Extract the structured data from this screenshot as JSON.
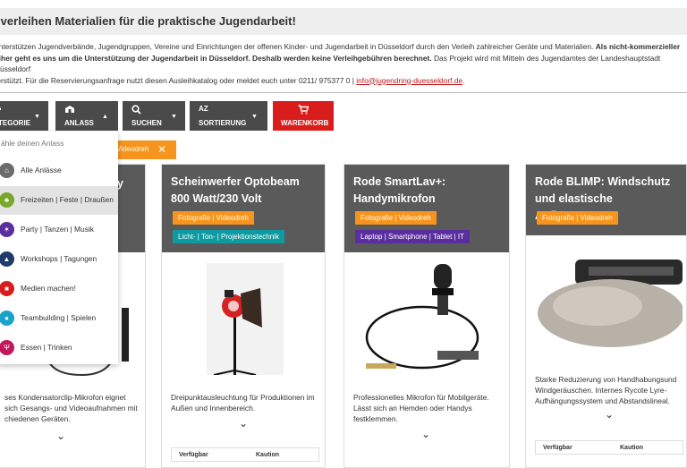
{
  "header": {
    "title": "r verleihen Materialien für die praktische Jugendarbeit!"
  },
  "intro": {
    "line1_normal": "unterstützen Jugendverbände, Jugendgruppen, Vereine und Einrichtungen der offenen Kinder- und Jugendarbeit in Düsseldorf durch den Verleih zahlreicher Geräte und Materialien. ",
    "line1_bold": "Als nicht-kommerzieller",
    "line2_bold": "eiher geht es uns um die Unterstützung der Jugendarbeit in Düsseldorf. Deshalb werden keine Verleihgebühren berechnet.",
    "line2_normal": " Das Projekt wird mit Mitteln des Jugendamtes der Landeshauptstadt Düsseldorf",
    "line3": "terstützt.  Für die Reservierungsanfrage nutzt diesen Ausleihkatalog oder meldet euch unter 0211/ 975377 0 | ",
    "email": "info@jugendring-duesseldorf.de",
    "line3_end": "."
  },
  "filters": {
    "kategorie": "TEGORIE",
    "anlass": "ANLASS",
    "suchen": "SUCHEN",
    "sortierung": "SORTIERUNG",
    "warenkorb": "WARENKORB",
    "sort_icon": "AZ"
  },
  "active_chip": {
    "label": "Videodreh"
  },
  "dropdown": {
    "header": "ähle deinen Anlass",
    "items": [
      {
        "label": "Alle Anlässe",
        "icon": "home-icon",
        "color": "#6b6b6b"
      },
      {
        "label": "Freizeiten | Feste | Draußen",
        "icon": "tree-icon",
        "color": "#7aa62b"
      },
      {
        "label": "Party | Tanzen | Musik",
        "icon": "sparkle-icon",
        "color": "#5b2ea0"
      },
      {
        "label": "Workshops | Tagungen",
        "icon": "graduation-cap-icon",
        "color": "#1f3b6b"
      },
      {
        "label": "Medien machen!",
        "icon": "video-camera-icon",
        "color": "#d91c1c"
      },
      {
        "label": "Teambuilding | Spielen",
        "icon": "people-icon",
        "color": "#1aa3c8"
      },
      {
        "label": "Essen | Trinken",
        "icon": "cutlery-icon",
        "color": "#c2185b"
      }
    ]
  },
  "cards": [
    {
      "title_partial": "y",
      "desc": "ses Kondensatorclip-Mikrofon eignet sich Gesangs- und Videoaufnahmen mit chiedenen Geräten."
    },
    {
      "title": "Scheinwerfer Optobeam 800 Watt/230 Volt",
      "tags": [
        "Fotografie | Videodreh",
        "Licht- | Ton- | Projektionstechnik"
      ],
      "desc": "Dreipunktausleuchtung für Produktionen im Außen und Innenbereich.",
      "table": {
        "col1": "Verfügbar",
        "col2": "Kaution"
      }
    },
    {
      "title": "Rode SmartLav+: Handymikrofon",
      "tags": [
        "Fotografie | Videodreh",
        "Laptop | Smartphone | Tablet | IT"
      ],
      "desc": "Professionelles Mikrofon für Mobilgeräte. Lässt sich an Hemden oder Handys festklemmen."
    },
    {
      "title": "Rode BLIMP: Windschutz und elastische Aufhängung",
      "tags": [
        "Fotografie | Videodreh"
      ],
      "desc": "Starke Reduzierung von Handhabungsund Windgeräuschen. Internes Rycote Lyre-Aufhängungssystem und Abstandslineal.",
      "table": {
        "col1": "Verfügbar",
        "col2": "Kaution"
      }
    }
  ],
  "colors": {
    "accent_red": "#d91c1c",
    "accent_orange": "#f7941d",
    "button_dark": "#4a4a4a",
    "card_header": "#5a5a5a"
  }
}
